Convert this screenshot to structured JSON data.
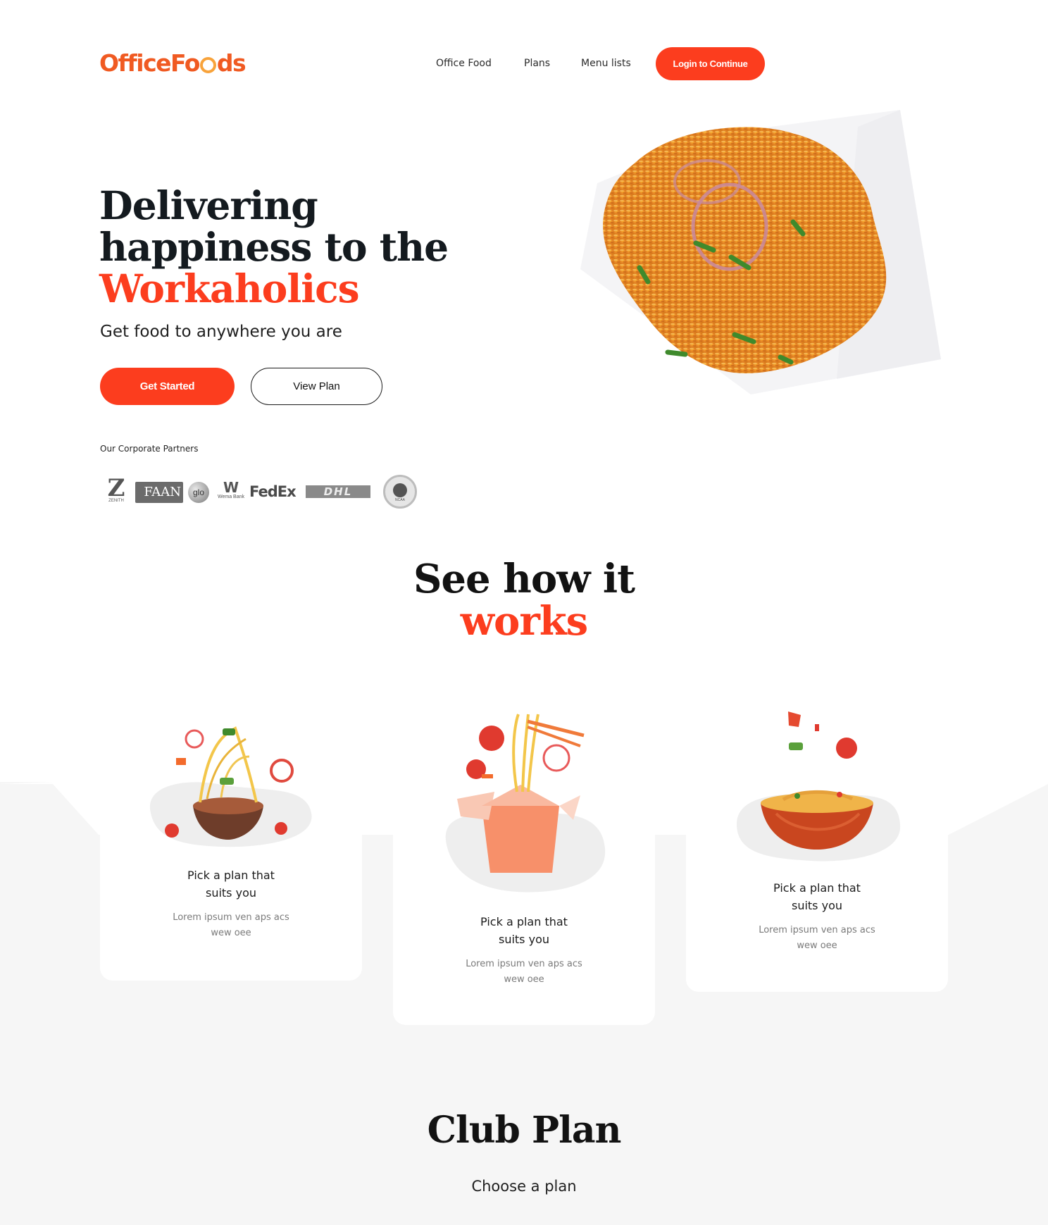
{
  "brand": {
    "logo_part1": "OfficeFo",
    "logo_part2": "ds"
  },
  "nav": {
    "items": [
      "Office Food",
      "Plans",
      "Menu lists"
    ],
    "login_label": "Login to Continue"
  },
  "hero": {
    "title_line1": "Delivering",
    "title_line2": "happiness to the",
    "title_accent": "Workaholics",
    "subtitle": "Get food to anywhere you are",
    "primary_button": "Get Started",
    "secondary_button": "View Plan",
    "partners_label": "Our Corporate Partners",
    "partners": [
      "ZENITH",
      "FAAN",
      "glo",
      "Wema Bank",
      "FedEx",
      "DHL",
      "NCAA"
    ],
    "image": "jollof-rice-plate"
  },
  "how": {
    "title_line1": "See how it",
    "title_accent": "works",
    "cards": [
      {
        "title": "Pick a plan that suits you",
        "description": "Lorem ipsum ven aps acs wew oee",
        "illustration": "noodle-bowl"
      },
      {
        "title": "Pick a plan that suits you",
        "description": "Lorem ipsum ven aps acs wew oee",
        "illustration": "noodle-box"
      },
      {
        "title": "Pick a plan that suits you",
        "description": "Lorem ipsum ven aps acs wew oee",
        "illustration": "red-bowl"
      }
    ]
  },
  "club": {
    "title": "Club Plan",
    "subtitle": "Choose a plan"
  },
  "colors": {
    "accent": "#fc3d1e",
    "logo_orange": "#f05a22",
    "dark": "#141a1f",
    "band": "#f6f6f6"
  }
}
